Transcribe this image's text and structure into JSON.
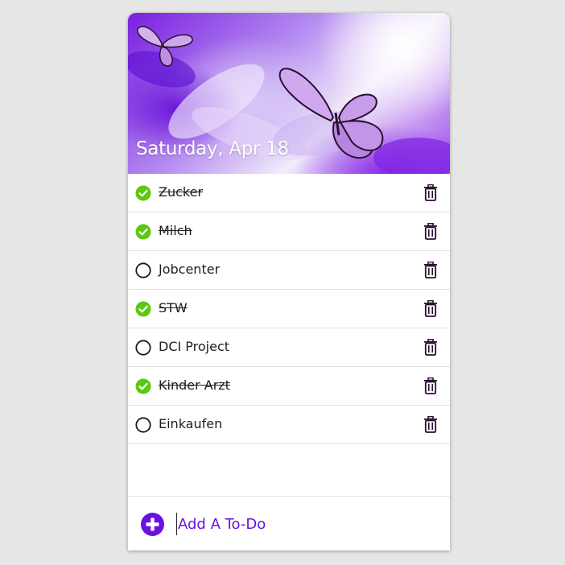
{
  "header": {
    "date": "Saturday, Apr 18",
    "background": "purple-flowers-butterflies-photo"
  },
  "todos": [
    {
      "label": "Zucker",
      "done": true
    },
    {
      "label": "Milch",
      "done": true
    },
    {
      "label": "Jobcenter",
      "done": false
    },
    {
      "label": "STW",
      "done": true
    },
    {
      "label": "DCI Project",
      "done": false
    },
    {
      "label": "Kinder Arzt",
      "done": true
    },
    {
      "label": "Einkaufen",
      "done": false
    }
  ],
  "icons": {
    "done": "check-circle-icon",
    "open": "empty-circle-icon",
    "delete": "trash-icon",
    "add": "plus-circle-icon"
  },
  "colors": {
    "done_check": "#5cc80f",
    "accent": "#6a11e0",
    "trash": "#2a1030"
  },
  "add": {
    "placeholder": "Add A To-Do"
  }
}
